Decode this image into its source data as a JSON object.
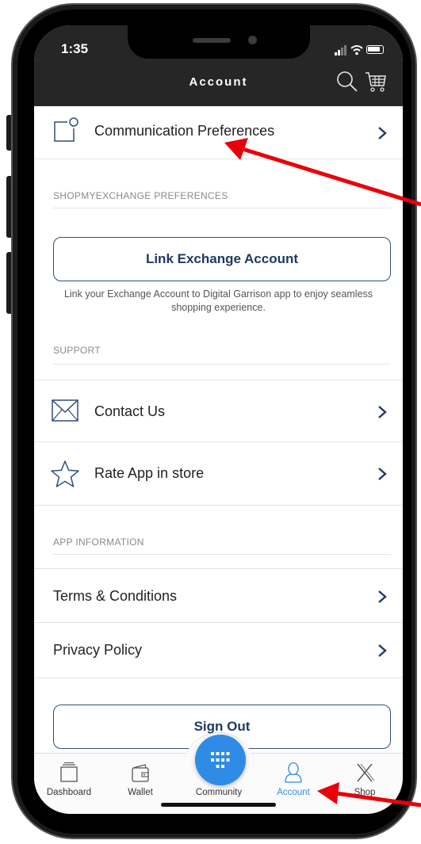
{
  "status_bar": {
    "time": "1:35"
  },
  "header": {
    "title": "Account",
    "search_icon": "search-icon",
    "cart_icon": "cart-icon"
  },
  "rows": {
    "communication": {
      "label": "Communication Preferences",
      "icon": "notification-icon"
    },
    "contact": {
      "label": "Contact Us",
      "icon": "envelope-icon"
    },
    "rate": {
      "label": "Rate App in store",
      "icon": "star-icon"
    },
    "terms": {
      "label": "Terms & Conditions"
    },
    "privacy": {
      "label": "Privacy Policy"
    }
  },
  "sections": {
    "shop": "SHOPMYEXCHANGE PREFERENCES",
    "support": "SUPPORT",
    "app_info": "APP INFORMATION"
  },
  "link_account": {
    "button": "Link Exchange Account",
    "help_line1": "Link your Exchange Account to Digital Garrison app to enjoy seamless",
    "help_line2": "shopping experience."
  },
  "sign_out": "Sign Out",
  "tabbar": {
    "tabs": [
      {
        "label": "Dashboard",
        "icon": "dashboard-icon",
        "active": false
      },
      {
        "label": "Wallet",
        "icon": "wallet-icon",
        "active": false
      },
      {
        "label": "Community",
        "icon": "grid-icon",
        "active": false
      },
      {
        "label": "Account",
        "icon": "person-icon",
        "active": true
      },
      {
        "label": "Shop",
        "icon": "exchange-x-icon",
        "active": false
      }
    ]
  },
  "colors": {
    "header_bg": "#262626",
    "accent_blue": "#2e8be6",
    "button_border": "#2f4e7a",
    "annotation_red": "#e8000b"
  }
}
